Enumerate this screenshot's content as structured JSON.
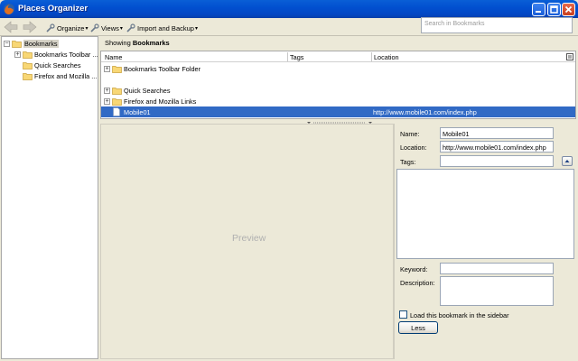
{
  "window": {
    "title": "Places Organizer"
  },
  "toolbar": {
    "organize_label": "Organize",
    "views_label": "Views",
    "import_label": "Import and Backup",
    "search_placeholder": "Search in Bookmarks"
  },
  "tree": {
    "items": [
      {
        "label": "Bookmarks",
        "expander": "−"
      },
      {
        "label": "Bookmarks Toolbar ...",
        "expander": "+"
      },
      {
        "label": "Quick Searches"
      },
      {
        "label": "Firefox and Mozilla ..."
      }
    ]
  },
  "content": {
    "showing_prefix": "Showing",
    "showing_folder": "Bookmarks",
    "columns": {
      "name": "Name",
      "tags": "Tags",
      "location": "Location"
    },
    "rows": [
      {
        "name": "Bookmarks Toolbar Folder",
        "location": ""
      },
      {
        "name": "Quick Searches",
        "location": ""
      },
      {
        "name": "Firefox and Mozilla Links",
        "location": ""
      },
      {
        "name": "Mobile01",
        "location": "http://www.mobile01.com/index.php"
      }
    ],
    "preview_label": "Preview"
  },
  "details": {
    "name_label": "Name:",
    "name_value": "Mobile01",
    "location_label": "Location:",
    "location_value": "http://www.mobile01.com/index.php",
    "tags_label": "Tags:",
    "tags_value": "",
    "keyword_label": "Keyword:",
    "keyword_value": "",
    "description_label": "Description:",
    "description_value": "",
    "sidebar_label": "Load this bookmark in the sidebar",
    "sidebar_checked": false,
    "less_label": "Less"
  },
  "colors": {
    "titlebar": "#0250d0",
    "selection": "#316ac5",
    "chrome": "#ece9d8"
  }
}
